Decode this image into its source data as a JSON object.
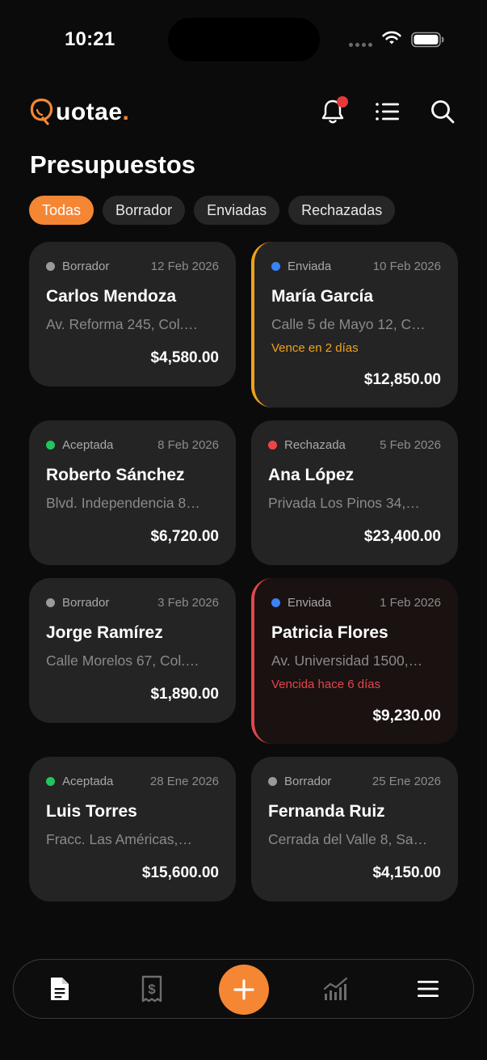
{
  "status_bar": {
    "time": "10:21"
  },
  "header": {
    "logo_text": "uotae",
    "logo_dot": "."
  },
  "page": {
    "title": "Presupuestos"
  },
  "filters": [
    {
      "label": "Todas",
      "active": true
    },
    {
      "label": "Borrador",
      "active": false
    },
    {
      "label": "Enviadas",
      "active": false
    },
    {
      "label": "Rechazadas",
      "active": false
    }
  ],
  "colors": {
    "accent": "#f58634",
    "status_borrador": "#9a9a9a",
    "status_enviada": "#3b82f6",
    "status_aceptada": "#22c55e",
    "status_rechazada": "#ef4444",
    "warning": "#f0a21b",
    "danger": "#e0474c"
  },
  "quotes": [
    {
      "status": "Borrador",
      "date": "12 Feb 2026",
      "client": "Carlos Mendoza",
      "address": "Av. Reforma 245, Col.…",
      "note": "",
      "amount": "$4,580.00"
    },
    {
      "status": "Enviada",
      "date": "10 Feb 2026",
      "client": "María García",
      "address": "Calle 5 de Mayo 12, C…",
      "note": "Vence en 2 días",
      "amount": "$12,850.00"
    },
    {
      "status": "Aceptada",
      "date": "8 Feb 2026",
      "client": "Roberto Sánchez",
      "address": "Blvd. Independencia 8…",
      "note": "",
      "amount": "$6,720.00"
    },
    {
      "status": "Rechazada",
      "date": "5 Feb 2026",
      "client": "Ana López",
      "address": "Privada Los Pinos 34,…",
      "note": "",
      "amount": "$23,400.00"
    },
    {
      "status": "Borrador",
      "date": "3 Feb 2026",
      "client": "Jorge Ramírez",
      "address": "Calle Morelos 67, Col.…",
      "note": "",
      "amount": "$1,890.00"
    },
    {
      "status": "Enviada",
      "date": "1 Feb 2026",
      "client": "Patricia Flores",
      "address": "Av. Universidad 1500,…",
      "note": "Vencida hace 6 días",
      "amount": "$9,230.00"
    },
    {
      "status": "Aceptada",
      "date": "28 Ene 2026",
      "client": "Luis Torres",
      "address": "Fracc. Las Américas,…",
      "note": "",
      "amount": "$15,600.00"
    },
    {
      "status": "Borrador",
      "date": "25 Ene 2026",
      "client": "Fernanda Ruiz",
      "address": "Cerrada del Valle 8, Sa…",
      "note": "",
      "amount": "$4,150.00"
    }
  ],
  "bottom_nav": {
    "items": [
      "document-icon",
      "receipt-icon",
      "plus-icon",
      "chart-icon",
      "menu-icon"
    ]
  }
}
